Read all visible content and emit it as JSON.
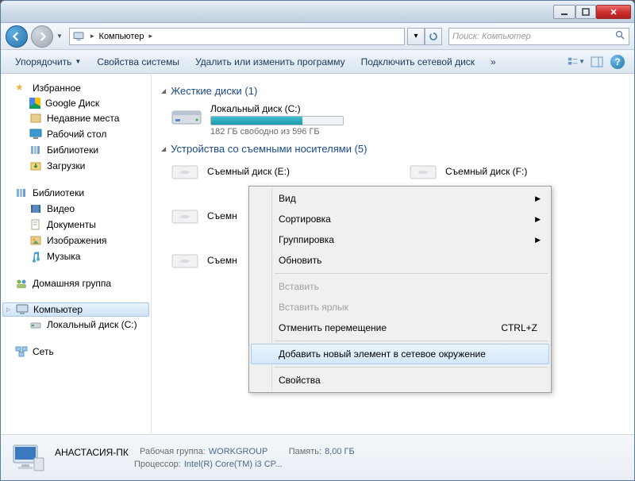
{
  "titlebar": {
    "min": "—",
    "max": "☐",
    "close": "✕"
  },
  "nav": {
    "crumb_root": "Компьютер",
    "search_placeholder": "Поиск: Компьютер"
  },
  "toolbar": {
    "organize": "Упорядочить",
    "props": "Свойства системы",
    "uninstall": "Удалить или изменить программу",
    "map_drive": "Подключить сетевой диск",
    "more": "»"
  },
  "sidebar": {
    "favorites": {
      "header": "Избранное",
      "items": [
        "Google Диск",
        "Недавние места",
        "Рабочий стол",
        "Библиотеки",
        "Загрузки"
      ]
    },
    "libraries": {
      "header": "Библиотеки",
      "items": [
        "Видео",
        "Документы",
        "Изображения",
        "Музыка"
      ]
    },
    "homegroup": "Домашняя группа",
    "computer": {
      "header": "Компьютер",
      "items": [
        "Локальный диск (C:)"
      ]
    },
    "network": "Сеть"
  },
  "content": {
    "hdd_section": "Жесткие диски (1)",
    "c_drive": {
      "name": "Локальный диск (C:)",
      "free_text": "182 ГБ свободно из 596 ГБ",
      "fill_pct": 69
    },
    "rem_section": "Устройства со съемными носителями (5)",
    "removable": [
      "Съемный диск (E:)",
      "Съемный диск (F:)",
      "Съемн",
      "Съемн"
    ]
  },
  "context_menu": {
    "view": "Вид",
    "sort": "Сортировка",
    "group": "Группировка",
    "refresh": "Обновить",
    "paste": "Вставить",
    "paste_shortcut": "Вставить ярлык",
    "undo_move": "Отменить перемещение",
    "undo_sc": "CTRL+Z",
    "add_network": "Добавить новый элемент в сетевое окружение",
    "properties": "Свойства"
  },
  "details": {
    "pc_name": "АНАСТАСИЯ-ПК",
    "workgroup_k": "Рабочая группа:",
    "workgroup_v": "WORKGROUP",
    "mem_k": "Память:",
    "mem_v": "8,00 ГБ",
    "cpu_k": "Процессор:",
    "cpu_v": "Intel(R) Core(TM) i3 CP..."
  }
}
